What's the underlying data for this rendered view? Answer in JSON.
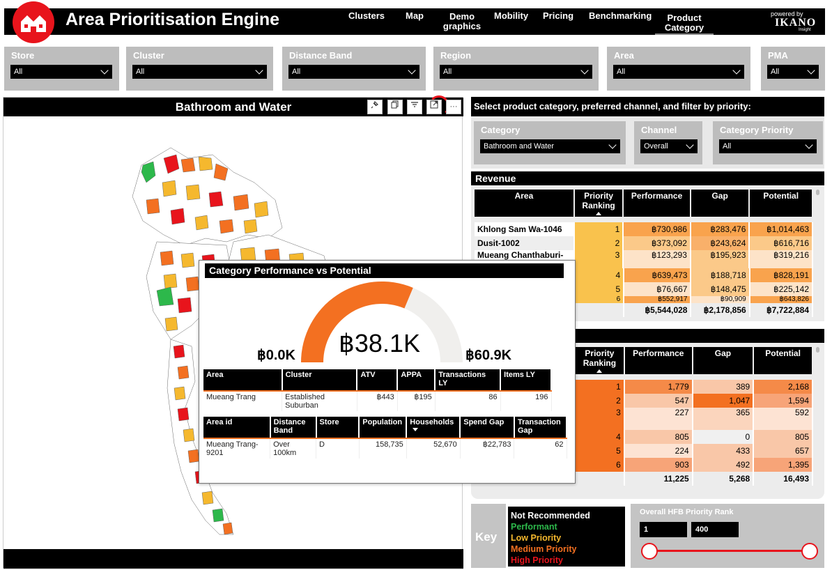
{
  "header": {
    "title": "Area Prioritisation Engine",
    "tabs": [
      {
        "id": "clusters",
        "label": "Clusters"
      },
      {
        "id": "map",
        "label": "Map"
      },
      {
        "id": "demographics",
        "label": "Demo graphics"
      },
      {
        "id": "mobility",
        "label": "Mobility"
      },
      {
        "id": "pricing",
        "label": "Pricing"
      },
      {
        "id": "benchmarking",
        "label": "Benchmarking"
      },
      {
        "id": "product-category",
        "label": "Product Category"
      }
    ],
    "active_tab": "Product Category",
    "powered_by": "powered by",
    "brand": "IKANO",
    "brand_sub": "Insight"
  },
  "filters": [
    {
      "label": "Store",
      "value": "All"
    },
    {
      "label": "Cluster",
      "value": "All"
    },
    {
      "label": "Distance Band",
      "value": "All"
    },
    {
      "label": "Region",
      "value": "All"
    },
    {
      "label": "Area",
      "value": "All"
    },
    {
      "label": "PMA",
      "value": "All"
    }
  ],
  "map_panel": {
    "title": "Bathroom and Water",
    "toolbar": [
      "pin-icon",
      "copy-icon",
      "filter-icon",
      "focus-mode-icon",
      "more-options-icon"
    ]
  },
  "selection": {
    "instruction": "Select product category, preferred channel, and filter by priority:",
    "category": {
      "label": "Category",
      "value": "Bathroom and Water"
    },
    "channel": {
      "label": "Channel",
      "value": "Overall"
    },
    "priority": {
      "label": "Category Priority",
      "value": "All"
    }
  },
  "revenue": {
    "title": "Revenue",
    "headers": [
      "Area",
      "Priority Ranking",
      "Performance",
      "Gap",
      "Potential"
    ],
    "rows": [
      {
        "area": "Khlong Sam Wa-1046",
        "rank": "1",
        "performance": "฿730,986",
        "gap": "฿283,476",
        "potential": "฿1,014,463"
      },
      {
        "area": "Dusit-1002",
        "rank": "2",
        "performance": "฿373,092",
        "gap": "฿243,624",
        "potential": "฿616,716"
      },
      {
        "area": "Mueang Chanthaburi-",
        "rank": "3",
        "performance": "฿123,293",
        "gap": "฿195,923",
        "potential": "฿319,216"
      },
      {
        "area": "",
        "rank": "4",
        "performance": "฿639,473",
        "gap": "฿188,718",
        "potential": "฿828,191"
      },
      {
        "area": "",
        "rank": "5",
        "performance": "฿76,667",
        "gap": "฿148,475",
        "potential": "฿225,142"
      },
      {
        "area": "",
        "rank": "6",
        "performance": "฿552,917",
        "gap": "฿90,909",
        "potential": "฿643,826"
      }
    ],
    "totals": {
      "performance": "฿5,544,028",
      "gap": "฿2,178,856",
      "potential": "฿7,722,884"
    }
  },
  "units": {
    "headers": [
      "Priority Ranking",
      "Performance",
      "Gap",
      "Potential"
    ],
    "rows": [
      {
        "rank": "1",
        "performance": "1,779",
        "gap": "389",
        "potential": "2,168"
      },
      {
        "rank": "2",
        "performance": "547",
        "gap": "1,047",
        "potential": "1,594"
      },
      {
        "rank": "3",
        "performance": "227",
        "gap": "365",
        "potential": "592"
      },
      {
        "rank": "4",
        "performance": "805",
        "gap": "0",
        "potential": "805"
      },
      {
        "rank": "5",
        "performance": "224",
        "gap": "433",
        "potential": "657"
      },
      {
        "rank": "6",
        "performance": "903",
        "gap": "492",
        "potential": "1,395"
      }
    ],
    "totals": {
      "performance": "11,225",
      "gap": "5,268",
      "potential": "16,493"
    }
  },
  "key": {
    "label": "Key",
    "items": [
      {
        "label": "Not Recommended",
        "color": "#ffffff"
      },
      {
        "label": "Performant",
        "color": "#2db84b"
      },
      {
        "label": "Low Priority",
        "color": "#f5b82e"
      },
      {
        "label": "Medium Priority",
        "color": "#f37021"
      },
      {
        "label": "High Priority",
        "color": "#e8141c"
      }
    ]
  },
  "rank_slider": {
    "label": "Overall HFB Priority Rank",
    "min_value": "1",
    "max_value": "400"
  },
  "popup": {
    "title": "Category Performance vs Potential",
    "gauge": {
      "value": "฿38.1K",
      "min": "฿0.0K",
      "max": "฿60.9K",
      "fraction": 0.626
    },
    "table1": {
      "headers": [
        "Area",
        "Cluster",
        "ATV",
        "APPA",
        "Transactions LY",
        "Items LY"
      ],
      "row": [
        "Mueang Trang",
        "Established Suburban",
        "฿443",
        "฿195",
        "86",
        "196"
      ]
    },
    "table2": {
      "headers": [
        "Area id",
        "Distance Band",
        "Store",
        "Population",
        "Households",
        "Spend Gap",
        "Transaction Gap"
      ],
      "row": [
        "Mueang Trang-9201",
        "Over 100km",
        "D",
        "158,735",
        "52,670",
        "฿22,783",
        "62"
      ]
    }
  },
  "colors": {
    "accent_red": "#e8141c",
    "orange": "#f37021",
    "light_grey": "#bdbdbd"
  }
}
